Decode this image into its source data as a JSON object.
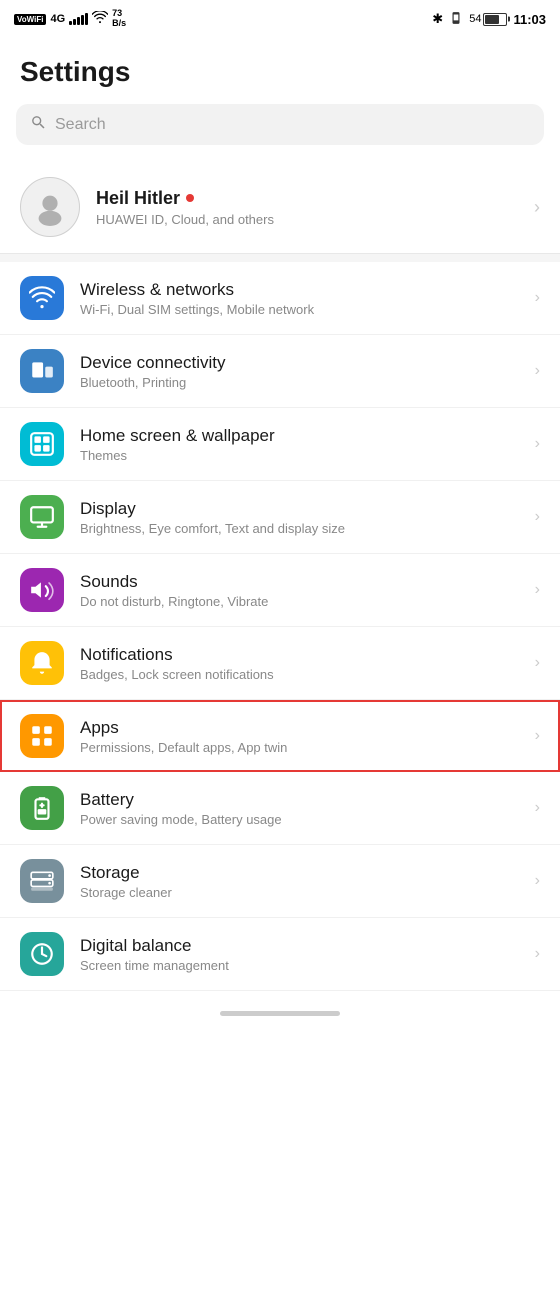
{
  "statusBar": {
    "left": {
      "vowifi": "VoWiFi",
      "signal": "4G",
      "speed": "73\nB/s"
    },
    "right": {
      "battery": "54",
      "time": "11:03"
    }
  },
  "pageTitle": "Settings",
  "search": {
    "placeholder": "Search"
  },
  "profile": {
    "name": "Heil Hitler",
    "subtitle": "HUAWEI ID, Cloud, and others"
  },
  "settingsItems": [
    {
      "id": "wireless",
      "title": "Wireless & networks",
      "subtitle": "Wi-Fi, Dual SIM settings, Mobile network",
      "iconColor": "bg-blue",
      "iconType": "wifi"
    },
    {
      "id": "device-connectivity",
      "title": "Device connectivity",
      "subtitle": "Bluetooth, Printing",
      "iconColor": "bg-blue2",
      "iconType": "devices"
    },
    {
      "id": "home-screen",
      "title": "Home screen & wallpaper",
      "subtitle": "Themes",
      "iconColor": "bg-green-teal",
      "iconType": "home"
    },
    {
      "id": "display",
      "title": "Display",
      "subtitle": "Brightness, Eye comfort, Text and display size",
      "iconColor": "bg-green",
      "iconType": "display"
    },
    {
      "id": "sounds",
      "title": "Sounds",
      "subtitle": "Do not disturb, Ringtone, Vibrate",
      "iconColor": "bg-purple",
      "iconType": "sound"
    },
    {
      "id": "notifications",
      "title": "Notifications",
      "subtitle": "Badges, Lock screen notifications",
      "iconColor": "bg-yellow",
      "iconType": "bell"
    },
    {
      "id": "apps",
      "title": "Apps",
      "subtitle": "Permissions, Default apps, App twin",
      "iconColor": "bg-orange",
      "iconType": "apps",
      "highlighted": true
    },
    {
      "id": "battery",
      "title": "Battery",
      "subtitle": "Power saving mode, Battery usage",
      "iconColor": "bg-green2",
      "iconType": "battery"
    },
    {
      "id": "storage",
      "title": "Storage",
      "subtitle": "Storage cleaner",
      "iconColor": "bg-gray",
      "iconType": "storage"
    },
    {
      "id": "digital-balance",
      "title": "Digital balance",
      "subtitle": "Screen time management",
      "iconColor": "bg-teal",
      "iconType": "hourglass"
    }
  ]
}
